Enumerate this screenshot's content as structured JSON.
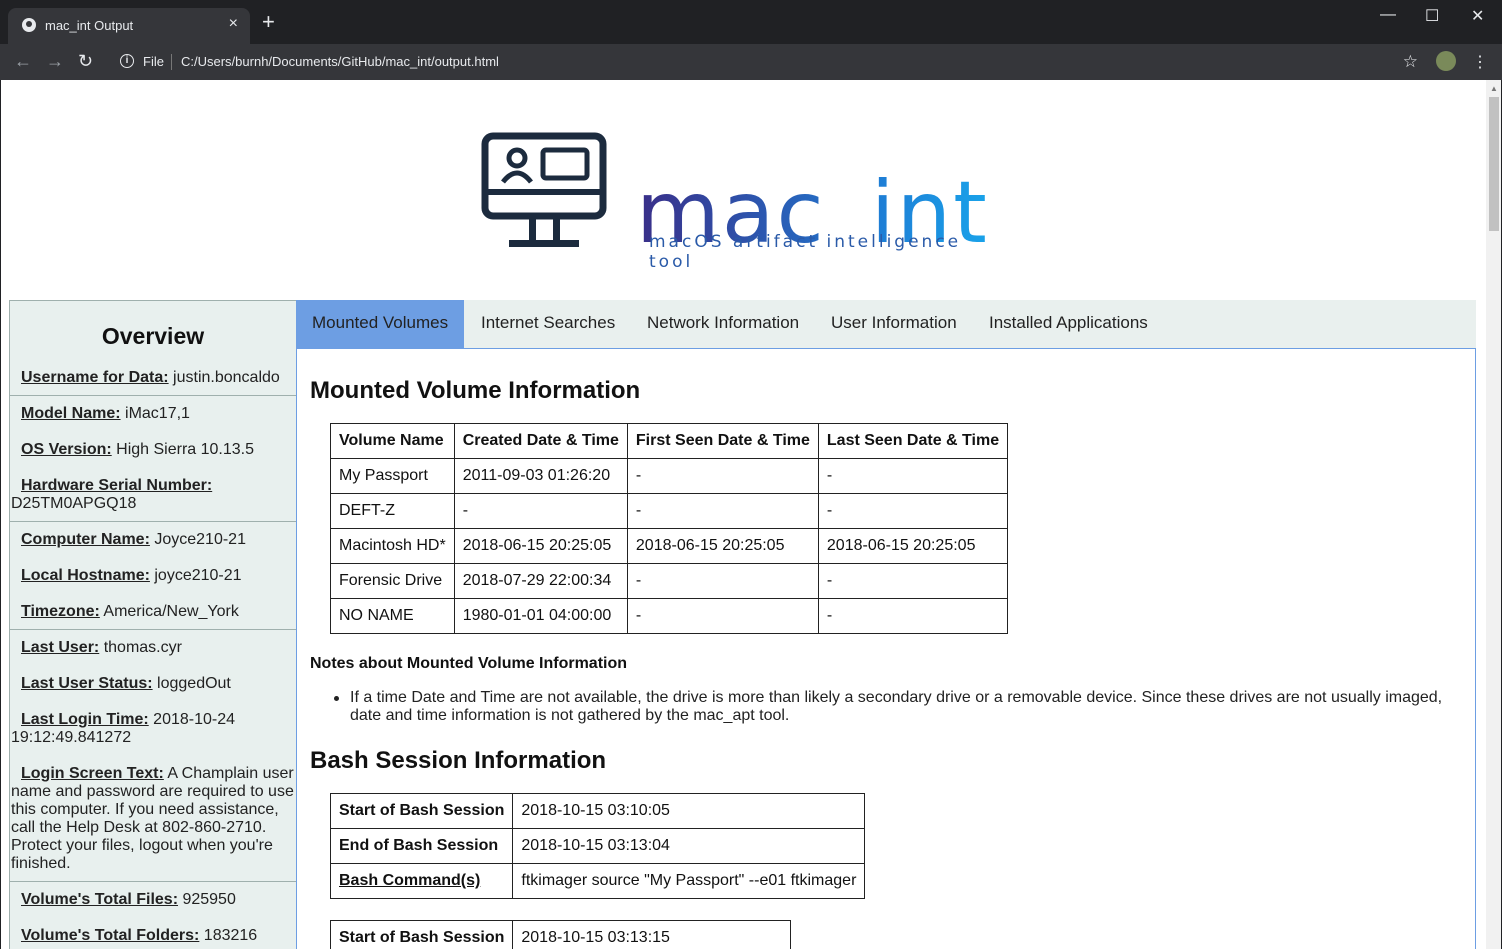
{
  "browser": {
    "tab_title": "mac_int Output",
    "tab_close": "×",
    "new_tab": "+",
    "minimize": "—",
    "maximize": "☐",
    "close": "✕",
    "back": "←",
    "forward": "→",
    "reload": "↻",
    "info": "i",
    "file_label": "File",
    "url": "C:/Users/burnh/Documents/GitHub/mac_int/output.html",
    "star": "☆",
    "menu": "⋮"
  },
  "logo": {
    "wordmark": "mac_int",
    "tagline": "macOS artifact intelligence tool"
  },
  "sidebar": {
    "title": "Overview",
    "items": [
      {
        "key": "Username for Data:",
        "value": " justin.boncaldo"
      },
      {
        "key": "Model Name:",
        "value": " iMac17,1"
      },
      {
        "key": "OS Version:",
        "value": " High Sierra 10.13.5"
      },
      {
        "key": "Hardware Serial Number:",
        "value": "D25TM0APGQ18"
      },
      {
        "key": "Computer Name:",
        "value": " Joyce210-21"
      },
      {
        "key": "Local Hostname:",
        "value": " joyce210-21"
      },
      {
        "key": "Timezone:",
        "value": " America/New_York"
      },
      {
        "key": "Last User:",
        "value": " thomas.cyr"
      },
      {
        "key": "Last User Status:",
        "value": " loggedOut"
      },
      {
        "key": "Last Login Time:",
        "value": " 2018-10-24 19:12:49.841272"
      },
      {
        "key": "Login Screen Text:",
        "value": " A Champlain user name and password are required to use this computer. If you need assistance, call the Help Desk at 802-860-2710. Protect your files, logout when you're finished."
      },
      {
        "key": "Volume's Total Files:",
        "value": " 925950"
      },
      {
        "key": "Volume's Total Folders:",
        "value": " 183216"
      }
    ]
  },
  "tabs": [
    "Mounted Volumes",
    "Internet Searches",
    "Network Information",
    "User Information",
    "Installed Applications"
  ],
  "main": {
    "mounted_heading": "Mounted Volume Information",
    "volume_table": {
      "headers": [
        "Volume Name",
        "Created Date & Time",
        "First Seen Date & Time",
        "Last Seen Date & Time"
      ],
      "rows": [
        [
          "My Passport",
          "2011-09-03 01:26:20",
          "-",
          "-"
        ],
        [
          "DEFT-Z",
          "-",
          "-",
          "-"
        ],
        [
          "Macintosh HD*",
          "2018-06-15 20:25:05",
          "2018-06-15 20:25:05",
          "2018-06-15 20:25:05"
        ],
        [
          "Forensic Drive",
          "2018-07-29 22:00:34",
          "-",
          "-"
        ],
        [
          "NO NAME",
          "1980-01-01 04:00:00",
          "-",
          "-"
        ]
      ]
    },
    "notes_title": "Notes about Mounted Volume Information",
    "notes": [
      "If a time Date and Time are not available, the drive is more than likely a secondary drive or a removable device. Since these drives are not usually imaged, date and time information is not gathered by the mac_apt tool."
    ],
    "bash_heading": "Bash Session Information",
    "bash_sessions": [
      {
        "start_label": "Start of Bash Session",
        "start": "2018-10-15 03:10:05",
        "end_label": "End of Bash Session",
        "end": "2018-10-15 03:13:04",
        "cmd_label": "Bash Command(s)",
        "cmd": "ftkimager source \"My Passport\" --e01 ftkimager"
      },
      {
        "start_label": "Start of Bash Session",
        "start": "2018-10-15 03:13:15"
      }
    ]
  }
}
